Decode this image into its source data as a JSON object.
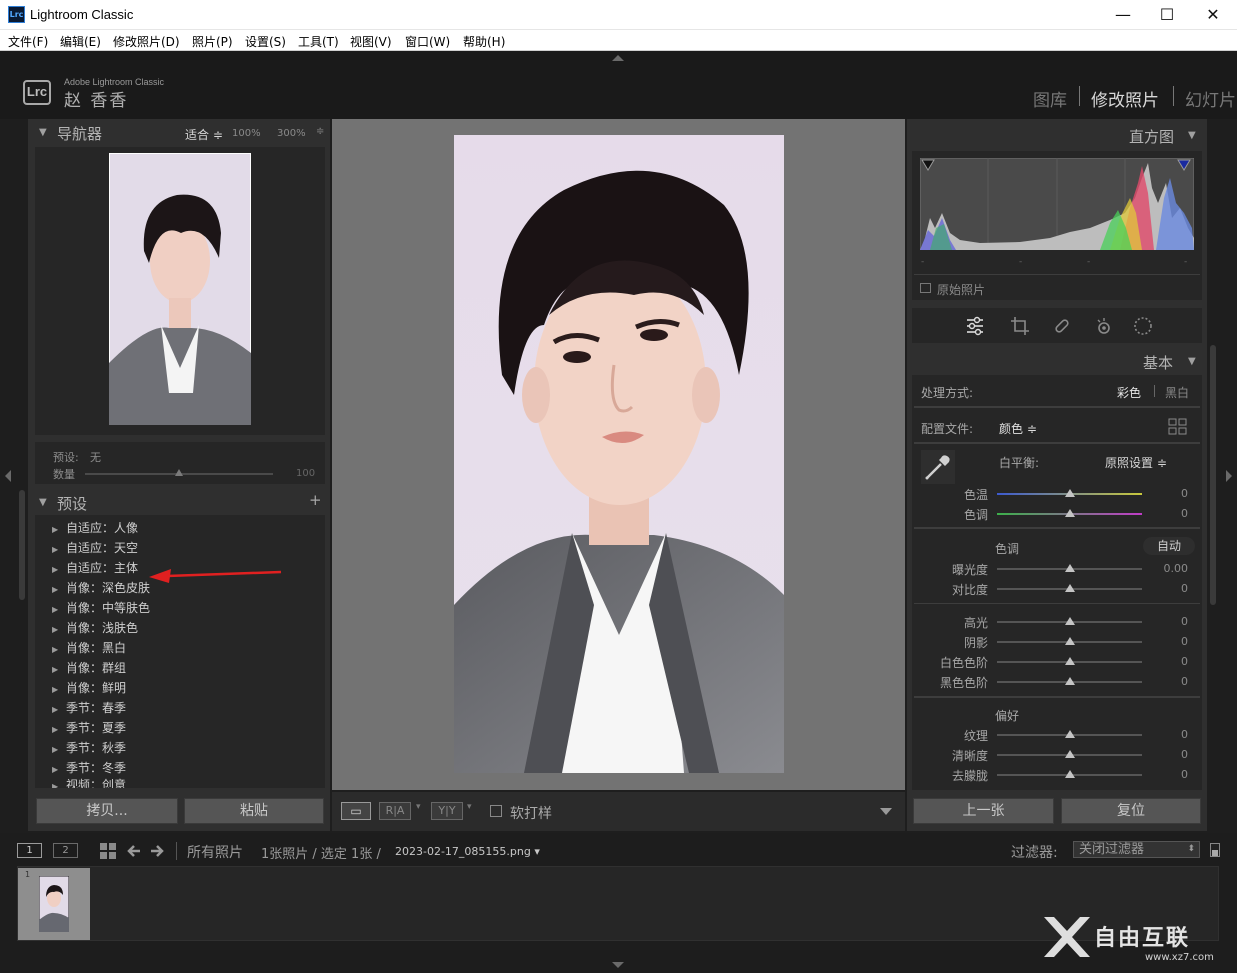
{
  "window": {
    "title": "Lightroom Classic",
    "app_icon": "Lrc",
    "minimize": "—",
    "maximize": "☐",
    "close": "✕"
  },
  "menu": [
    "文件(F)",
    "编辑(E)",
    "修改照片(D)",
    "照片(P)",
    "设置(S)",
    "工具(T)",
    "视图(V)",
    "窗口(W)",
    "帮助(H)"
  ],
  "identity": {
    "badge": "Lrc",
    "small": "Adobe Lightroom Classic",
    "name": "赵 香香"
  },
  "modules": [
    {
      "label": "图库",
      "active": false
    },
    {
      "label": "修改照片",
      "active": true
    },
    {
      "label": "幻灯片",
      "active": false
    }
  ],
  "navigator": {
    "title": "导航器",
    "fit": "适合 ≑",
    "zoom1": "100%",
    "zoom2": "300%",
    "zoom3": "≑"
  },
  "preset_amount": {
    "preset_label": "预设:",
    "preset_value": "无",
    "amount_label": "数量",
    "amount_value": "100",
    "amount_level": 0.5
  },
  "presets": {
    "title": "预设",
    "add": "+",
    "items": [
      "自适应：人像",
      "自适应：天空",
      "自适应：主体",
      "肖像：深色皮肤",
      "肖像：中等肤色",
      "肖像：浅肤色",
      "肖像：黑白",
      "肖像：群组",
      "肖像：鲜明",
      "季节：春季",
      "季节：夏季",
      "季节：秋季",
      "季节：冬季",
      "视频：创意"
    ]
  },
  "left_buttons": {
    "copy": "拷贝...",
    "paste": "粘贴"
  },
  "toolbar": {
    "view1": "▭",
    "view2": "R|A",
    "view3": "Y|Y",
    "softproof": "软打样"
  },
  "histogram": {
    "title": "直方图",
    "original_photo": "原始照片",
    "readouts": [
      "-",
      "-",
      "-",
      "-"
    ]
  },
  "tools": [
    "sliders",
    "crop",
    "heal",
    "redeye",
    "mask"
  ],
  "basic": {
    "title": "基本",
    "treatment_label": "处理方式:",
    "color": "彩色",
    "bw": "黑白",
    "profile_label": "配置文件:",
    "profile_value": "颜色 ≑",
    "wb_label": "白平衡:",
    "wb_value": "原照设置 ≑",
    "temp": {
      "label": "色温",
      "value": "0"
    },
    "tint": {
      "label": "色调",
      "value": "0"
    },
    "tone_label": "色调",
    "auto": "自动",
    "exposure": {
      "label": "曝光度",
      "value": "0.00"
    },
    "contrast": {
      "label": "对比度",
      "value": "0"
    },
    "highlights": {
      "label": "高光",
      "value": "0"
    },
    "shadows": {
      "label": "阴影",
      "value": "0"
    },
    "whites": {
      "label": "白色色阶",
      "value": "0"
    },
    "blacks": {
      "label": "黑色色阶",
      "value": "0"
    },
    "presence_label": "偏好",
    "texture": {
      "label": "纹理",
      "value": "0"
    },
    "clarity": {
      "label": "清晰度",
      "value": "0"
    },
    "dehaze": {
      "label": "去朦胧",
      "value": "0"
    }
  },
  "right_buttons": {
    "prev": "上一张",
    "reset": "复位"
  },
  "filmstrip": {
    "screen1": "1",
    "screen2": "2",
    "source": "所有照片",
    "count": "1张照片 / 选定 1张 /",
    "filename": "2023-02-17_085155.png ▾",
    "filter_label": "过滤器:",
    "filter_value": "关闭过滤器",
    "thumb_index": "1"
  },
  "watermark": {
    "text": "自由互联",
    "url": "www.xz7.com"
  },
  "colors": {
    "accent": "#d8d8d8",
    "panel": "#2f2f2f",
    "annotation": "#e02020"
  }
}
